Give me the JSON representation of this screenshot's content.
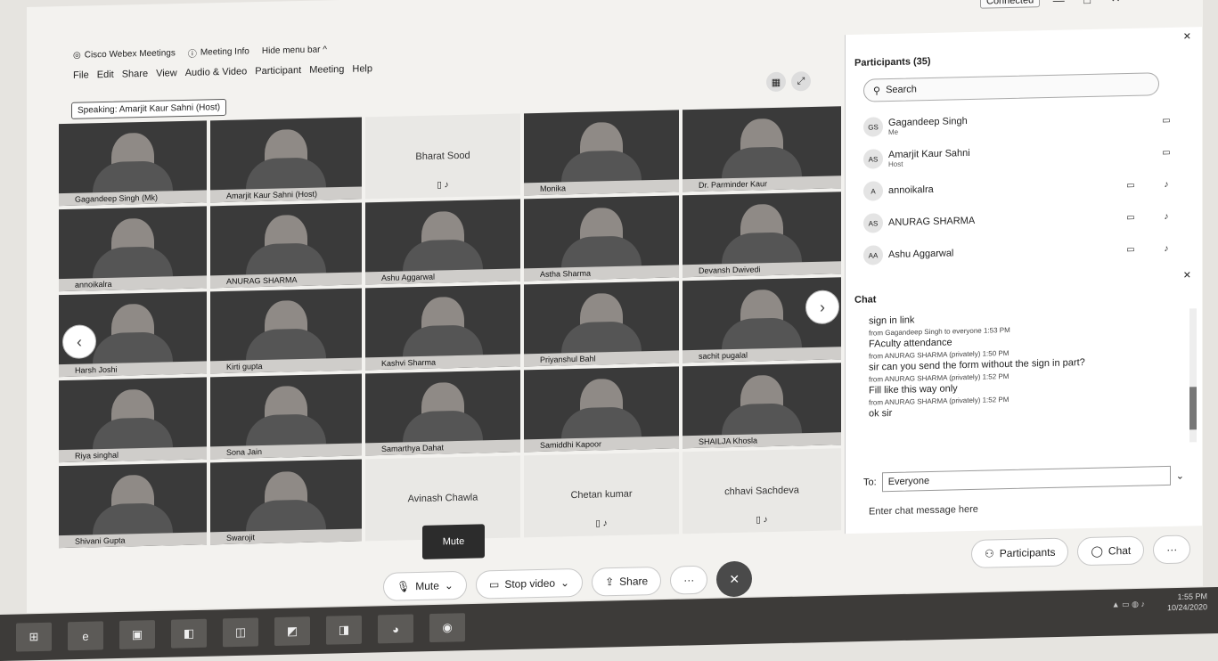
{
  "titlebar": {
    "status": "Connected",
    "minimize": "—",
    "maximize": "□",
    "close": "✕"
  },
  "tabs": {
    "app": "Cisco Webex Meetings",
    "info": "Meeting Info",
    "hide": "Hide menu bar ^"
  },
  "menu": [
    "File",
    "Edit",
    "Share",
    "View",
    "Audio & Video",
    "Participant",
    "Meeting",
    "Help"
  ],
  "speaking": "Speaking: Amarjit Kaur Sahni (Host)",
  "tiles": {
    "t1": "Gagandeep Singh (Mk)",
    "t2": "Amarjit Kaur Sahni (Host)",
    "t3": "Bharat Sood",
    "t4": "Monika",
    "t5": "Dr. Parminder Kaur",
    "t6": "annoikalra",
    "t7": "ANURAG SHARMA",
    "t8": "Ashu Aggarwal",
    "t9": "Astha Sharma",
    "t10": "Devansh Dwivedi",
    "t11": "Harsh Joshi",
    "t12": "Kirti gupta",
    "t13": "Kashvi Sharma",
    "t14": "Priyanshul Bahl",
    "t15": "sachit pugalal",
    "t16": "Riya singhal",
    "t17": "Sona Jain",
    "t18": "Samarthya Dahat",
    "t19": "Samiddhi Kapoor",
    "t20": "SHAILJA Khosla",
    "t21": "Shivani Gupta",
    "t22": "Swarojit",
    "t23": "Avinash Chawla",
    "t24": "Chetan kumar",
    "t25": "chhavi Sachdeva"
  },
  "mute_overlay": "Mute",
  "participants": {
    "title": "Participants (35)",
    "search_placeholder": "Search",
    "list": [
      {
        "initials": "GS",
        "name": "Gagandeep Singh",
        "role": "Me"
      },
      {
        "initials": "AS",
        "name": "Amarjit Kaur Sahni",
        "role": "Host"
      },
      {
        "initials": "A",
        "name": "annoikalra",
        "role": ""
      },
      {
        "initials": "AS",
        "name": "ANURAG SHARMA",
        "role": ""
      },
      {
        "initials": "AA",
        "name": "Ashu Aggarwal",
        "role": ""
      }
    ]
  },
  "chat": {
    "title": "Chat",
    "messages": [
      {
        "meta": "from Gagandeep Singh to everyone   1:53 PM",
        "text": "sign in link"
      },
      {
        "meta": "from ANURAG SHARMA (privately)   1:50 PM",
        "text": "FAculty attendance"
      },
      {
        "meta": "from ANURAG SHARMA (privately)   1:52 PM",
        "text": "sir can you send the form without the sign in part?"
      },
      {
        "meta": "from ANURAG SHARMA (privately)   1:52 PM",
        "text": "Fill like this way only"
      },
      {
        "meta": "",
        "text": "ok sir"
      }
    ],
    "to_label": "To:",
    "to_value": "Everyone",
    "entry_placeholder": "Enter chat message here"
  },
  "controls": {
    "mute": "Mute",
    "stop_video": "Stop video",
    "share": "Share",
    "more": "···",
    "participants": "Participants",
    "chat": "Chat"
  },
  "taskbar": {
    "time": "1:55 PM",
    "date": "10/24/2020"
  }
}
